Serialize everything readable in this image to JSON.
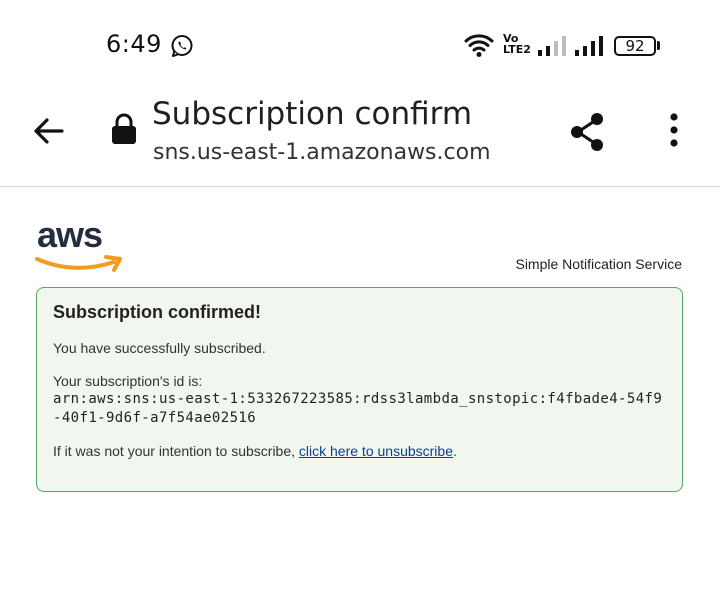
{
  "status_bar": {
    "time": "6:49",
    "volte_top": "Vo",
    "volte_bottom": "LTE2",
    "battery": "92"
  },
  "app_bar": {
    "title": "Subscription confirm",
    "url": "sns.us-east-1.amazonaws.com"
  },
  "page": {
    "logo_text": "aws",
    "service_name": "Simple Notification Service",
    "panel": {
      "title": "Subscription confirmed!",
      "success_text": "You have successfully subscribed.",
      "id_label": "Your subscription's id is:",
      "subscription_arn": "arn:aws:sns:us-east-1:533267223585:rdss3lambda_snstopic:f4fbade4-54f9-40f1-9d6f-a7f54ae02516",
      "unsubscribe_prefix": "If it was not your intention to subscribe, ",
      "unsubscribe_link": "click here to unsubscribe",
      "unsubscribe_suffix": "."
    }
  },
  "colors": {
    "panel_border": "#5aa65a",
    "panel_background": "#f1f6ef",
    "link": "#0b3f94",
    "aws_smile": "#f29b1d"
  },
  "icons": [
    "whatsapp-icon",
    "wifi-icon",
    "signal-icon",
    "battery-icon",
    "back-arrow-icon",
    "lock-icon",
    "share-icon",
    "more-vert-icon",
    "aws-logo"
  ]
}
